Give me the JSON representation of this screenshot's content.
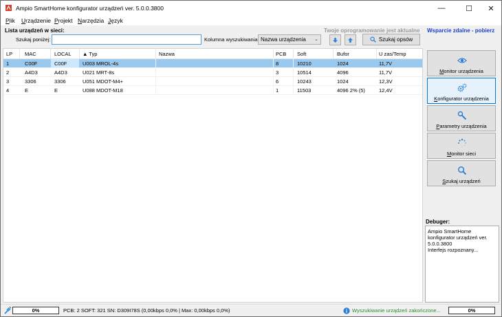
{
  "window": {
    "title": "Ampio SmartHome konfigurator urządzeń ver. 5.0.0.3800",
    "minimize_glyph": "—",
    "maximize_glyph": "☐",
    "close_glyph": "✕"
  },
  "menu": [
    "Plik",
    "Urządzenie",
    "Projekt",
    "Narzędzia",
    "Język"
  ],
  "header": {
    "list_label": "Lista urządzeń w sieci:",
    "update_note": "Twoje oprogramowanie jest aktualne",
    "support_link": "Wsparcie zdalne - pobierz"
  },
  "search": {
    "label": "Szukaj poniżej:",
    "value": "",
    "column_label": "Kolumna wyszukiwania:",
    "column_selected": "Nazwa urządzenia",
    "options_button": "Szukaj opsów"
  },
  "table": {
    "columns": [
      "LP",
      "MAC",
      "LOCAL",
      "▲ Typ",
      "Nazwa",
      "PCB",
      "Soft",
      "Bufor",
      "U zas/Temp"
    ],
    "rows": [
      [
        "1",
        "C00F",
        "C00F",
        "U003 MROL-4s",
        "",
        "8",
        "10210",
        "1024",
        "11,7V"
      ],
      [
        "2",
        "A4D3",
        "A4D3",
        "U021 MRT-8s",
        "",
        "3",
        "10514",
        "4096",
        "11,7V"
      ],
      [
        "3",
        "3306",
        "3306",
        "U051 MDOT-M4+",
        "",
        "6",
        "10243",
        "1024",
        "12,3V"
      ],
      [
        "4",
        "E",
        "E",
        "U088 MDOT-M18",
        "",
        "1",
        "11503",
        "4096 2% (5)",
        "12,4V"
      ]
    ]
  },
  "side_buttons": [
    {
      "label": "Monitor urządzenia",
      "icon": "eye-icon"
    },
    {
      "label": "Konfigurator urządzenia",
      "icon": "gears-icon"
    },
    {
      "label": "Parametry urządzenia",
      "icon": "wrench-icon"
    },
    {
      "label": "Monitor sieci",
      "icon": "spinner-icon"
    },
    {
      "label": "Szukaj urządzeń",
      "icon": "search-icon"
    }
  ],
  "debugger": {
    "label": "Debuger:",
    "text": "Ampio SmartHome\nkonfigurator urządzeń ver.\n5.0.0.3800\nInterfejs rozpoznany..."
  },
  "status": {
    "progress_left": "0%",
    "info": "PCB: 2 SOFT: 321 SN: D309I78S (0,00kbps 0,0% | Max: 0,00kbps 0,0%)",
    "message": "Wyszukiwanie urządzeń zakończone...",
    "progress_right": "0%"
  },
  "colors": {
    "accent": "#0078d7",
    "link": "#1a3fcf",
    "selection": "#99c9ef",
    "success": "#2e8b2e",
    "icon_blue": "#2b7fd8"
  }
}
